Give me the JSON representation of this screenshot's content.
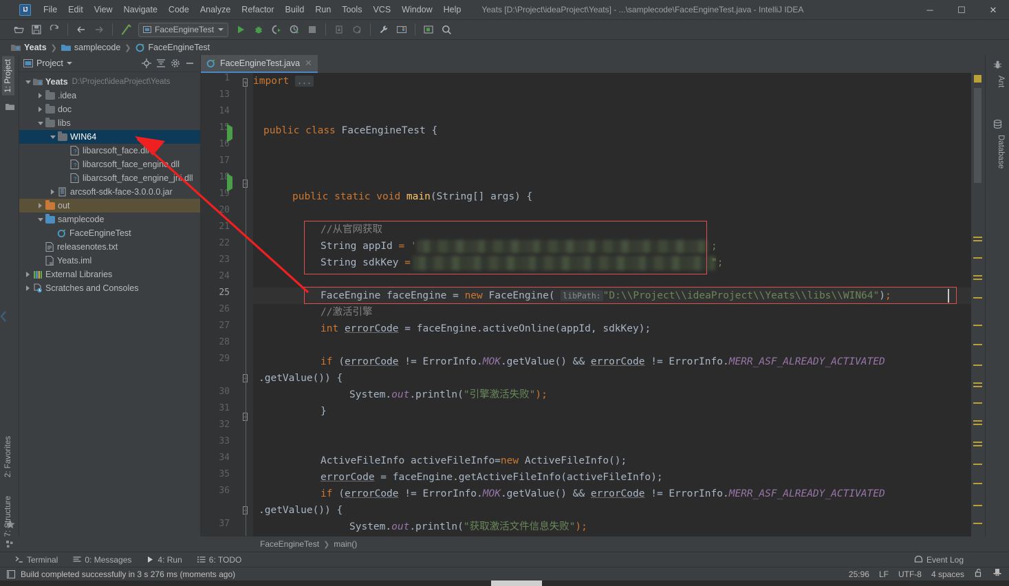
{
  "window": {
    "title": "Yeats [D:\\Project\\ideaProject\\Yeats] - ...\\samplecode\\FaceEngineTest.java - IntelliJ IDEA",
    "logo": "IJ",
    "minimize": "─",
    "maximize": "☐",
    "close": "✕"
  },
  "menu": [
    {
      "label": "File"
    },
    {
      "label": "Edit"
    },
    {
      "label": "View"
    },
    {
      "label": "Navigate"
    },
    {
      "label": "Code"
    },
    {
      "label": "Analyze"
    },
    {
      "label": "Refactor"
    },
    {
      "label": "Build"
    },
    {
      "label": "Run"
    },
    {
      "label": "Tools"
    },
    {
      "label": "VCS"
    },
    {
      "label": "Window"
    },
    {
      "label": "Help"
    }
  ],
  "toolbar": {
    "run_config": "FaceEngineTest",
    "icons": [
      "open-folder-icon",
      "save-icon",
      "sync-icon",
      "back-arrow-icon",
      "forward-arrow-icon",
      "build-hammer-icon"
    ],
    "run_icons": [
      "run-icon",
      "debug-icon",
      "run-coverage-icon",
      "profile-icon",
      "stop-icon",
      "update-project-icon",
      "commit-icon",
      "settings-wrench-icon",
      "project-structure-icon",
      "select-opened-file-icon",
      "search-icon"
    ]
  },
  "breadcrumb": {
    "items": [
      "Yeats",
      "samplecode",
      "FaceEngineTest"
    ]
  },
  "left_tool_tabs": [
    {
      "label": "1: Project",
      "active": true
    },
    {
      "label": "2: Favorites",
      "active": false
    },
    {
      "label": "7: Structure",
      "active": false
    }
  ],
  "right_tool_tabs": [
    {
      "label": "Ant"
    },
    {
      "label": "Database"
    }
  ],
  "project_panel": {
    "title": "Project",
    "header_icons": [
      "locate-icon",
      "collapse-all-icon",
      "settings-gear-icon",
      "hide-icon"
    ],
    "tree": [
      {
        "label": "Yeats",
        "path": "D:\\Project\\ideaProject\\Yeats",
        "depth": 0,
        "state": "expanded",
        "icon": "module-icon",
        "bold": true
      },
      {
        "label": ".idea",
        "depth": 1,
        "state": "collapsed",
        "icon": "folder-icon"
      },
      {
        "label": "doc",
        "depth": 1,
        "state": "collapsed",
        "icon": "folder-icon"
      },
      {
        "label": "libs",
        "depth": 1,
        "state": "expanded",
        "icon": "folder-icon"
      },
      {
        "label": "WIN64",
        "depth": 2,
        "state": "expanded",
        "icon": "folder-icon",
        "selected": true
      },
      {
        "label": "libarcsoft_face.dll",
        "depth": 3,
        "state": "leaf",
        "icon": "unknown-file-icon"
      },
      {
        "label": "libarcsoft_face_engine.dll",
        "depth": 3,
        "state": "leaf",
        "icon": "unknown-file-icon"
      },
      {
        "label": "libarcsoft_face_engine_jni.dll",
        "depth": 3,
        "state": "leaf",
        "icon": "unknown-file-icon"
      },
      {
        "label": "arcsoft-sdk-face-3.0.0.0.jar",
        "depth": 2,
        "state": "collapsed",
        "icon": "jar-icon"
      },
      {
        "label": "out",
        "depth": 1,
        "state": "collapsed",
        "icon": "folder-orange-icon",
        "tan": true
      },
      {
        "label": "samplecode",
        "depth": 1,
        "state": "expanded",
        "icon": "folder-blue-icon"
      },
      {
        "label": "FaceEngineTest",
        "depth": 2,
        "state": "leaf",
        "icon": "java-class-icon"
      },
      {
        "label": "releasenotes.txt",
        "depth": 1,
        "state": "leaf",
        "icon": "text-file-icon"
      },
      {
        "label": "Yeats.iml",
        "depth": 1,
        "state": "leaf",
        "icon": "iml-file-icon"
      },
      {
        "label": "External Libraries",
        "depth": 0,
        "state": "collapsed",
        "icon": "libraries-icon"
      },
      {
        "label": "Scratches and Consoles",
        "depth": 0,
        "state": "collapsed",
        "icon": "scratches-icon"
      }
    ]
  },
  "editor": {
    "tab": {
      "label": "FaceEngineTest.java",
      "icon": "java-class-icon",
      "close": "✕"
    },
    "line_numbers": [
      "1",
      "13",
      "14",
      "15",
      "16",
      "17",
      "18",
      "19",
      "20",
      "21",
      "22",
      "23",
      "24",
      "25",
      "26",
      "27",
      "28",
      "29",
      "",
      "30",
      "31",
      "32",
      "33",
      "34",
      "35",
      "36",
      "",
      "37"
    ],
    "current_line": "25",
    "redacted_note": "appId and sdkKey values are blurred / redacted in the screenshot",
    "code_lines": [
      "import ...",
      "",
      "",
      "public class FaceEngineTest {",
      "",
      "",
      "    public static void main(String[] args) {",
      "",
      "        //从官网获取",
      "        String appId = '██████████████';",
      "        String sdkKey = '██████████████\";",
      "",
      "",
      "        FaceEngine faceEngine = new FaceEngine( libPath: \"D:\\\\Project\\\\ideaProject\\\\Yeats\\\\libs\\\\WIN64\");",
      "        //激活引擎",
      "        int errorCode = faceEngine.activeOnline(appId, sdkKey);",
      "",
      "        if (errorCode != ErrorInfo.MOK.getValue() && errorCode != ErrorInfo.MERR_ASF_ALREADY_ACTIVATED",
      ".getValue()) {",
      "            System.out.println(\"引擎激活失败\");",
      "        }",
      "",
      "",
      "        ActiveFileInfo activeFileInfo=new ActiveFileInfo();",
      "        errorCode = faceEngine.getActiveFileInfo(activeFileInfo);",
      "        if (errorCode != ErrorInfo.MOK.getValue() && errorCode != ErrorInfo.MERR_ASF_ALREADY_ACTIVATED",
      ".getValue()) {",
      "            System.out.println(\"获取激活文件信息失败\");"
    ],
    "tokens": {
      "import": "import",
      "ellipsis": "...",
      "public": "public",
      "class": "class",
      "class_name": "FaceEngineTest",
      "static": "static",
      "void": "void",
      "main": "main",
      "string_arr": "String[] args",
      "comment_get_from_site": "//从官网获取",
      "string_kw": "String",
      "appid_var": "appId",
      "sdkkey_var": "sdkKey",
      "faceengine_type": "FaceEngine",
      "faceengine_var": "faceEngine",
      "new": "new",
      "libpath_hint": "libPath:",
      "libpath_value": "\"D:\\\\Project\\\\ideaProject\\\\Yeats\\\\libs\\\\WIN64\"",
      "comment_activate": "//激活引擎",
      "int": "int",
      "errorcode": "errorCode",
      "activeonline": "faceEngine.activeOnline(appId, sdkKey);",
      "if": "if",
      "errorinfo": "ErrorInfo.",
      "mok": "MOK",
      "getvalue": ".getValue()",
      "andand": "&&",
      "neq": "!=",
      "merr": "MERR_ASF_ALREADY_ACTIVATED",
      "getvalue_brace": ".getValue()) {",
      "sysout": "System.",
      "out": "out",
      "println": ".println(",
      "str_engine_fail": "\"引擎激活失败\"",
      "str_getfile_fail": "\"获取激活文件信息失败\"",
      "semi": ");",
      "close_brace": "}",
      "activefileinfo_type": "ActiveFileInfo",
      "activefileinfo_var": "activeFileInfo=",
      "activefileinfo_new": "ActiveFileInfo();",
      "getactivefileinfo": "faceEngine.getActiveFileInfo(activeFileInfo);",
      "eq": "="
    }
  },
  "bottom_breadcrumb": {
    "items": [
      "FaceEngineTest",
      "main()"
    ]
  },
  "tool_windows": [
    {
      "label": "Terminal",
      "icon": "terminal-icon"
    },
    {
      "label": "0: Messages",
      "icon": "messages-icon"
    },
    {
      "label": "4: Run",
      "icon": "run-icon"
    },
    {
      "label": "6: TODO",
      "icon": "todo-icon"
    }
  ],
  "event_log": {
    "label": "Event Log",
    "icon": "event-log-icon"
  },
  "status": {
    "message": "Build completed successfully in 3 s 276 ms (moments ago)",
    "caret_position": "25:96",
    "line_separator": "LF",
    "encoding": "UTF-8",
    "indent": "4 spaces",
    "lock_icon": "unlocked-icon",
    "inspection_icon": "inspector-hat-icon"
  },
  "colors": {
    "chrome": "#3c3f41",
    "editor_bg": "#2b2b2b",
    "gutter_bg": "#313335",
    "selection": "#0d3a58",
    "accent_blue": "#4a88c7",
    "annotation_red": "#e05252",
    "keyword_orange": "#cc7832",
    "string_green": "#6a8759",
    "method_yellow": "#ffc66d",
    "static_purple": "#9876aa",
    "marker_yellow": "#bba037"
  }
}
